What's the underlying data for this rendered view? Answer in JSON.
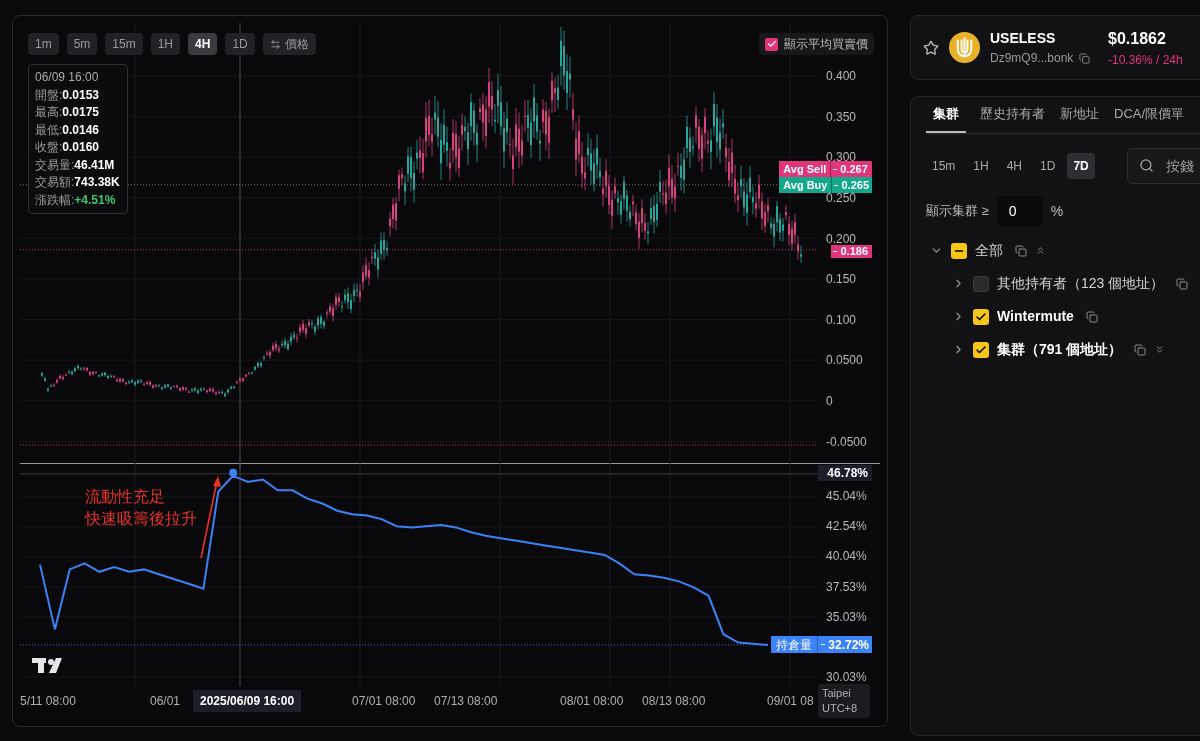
{
  "chart_panel": {
    "intervals": [
      {
        "label": "1m",
        "selected": false
      },
      {
        "label": "5m",
        "selected": false
      },
      {
        "label": "15m",
        "selected": false
      },
      {
        "label": "1H",
        "selected": false
      },
      {
        "label": "4H",
        "selected": true
      },
      {
        "label": "1D",
        "selected": false
      }
    ],
    "price_toggle": "價格",
    "avg_price_toggle": {
      "label": "顯示平均買賣價",
      "checked": true
    },
    "ohlc_tooltip": {
      "date": "06/09 16:00",
      "rows": [
        {
          "label": "開盤:",
          "value": "0.0153",
          "kind": "plain"
        },
        {
          "label": "最高:",
          "value": "0.0175",
          "kind": "plain"
        },
        {
          "label": "最低:",
          "value": "0.0146",
          "kind": "plain"
        },
        {
          "label": "收盤:",
          "value": "0.0160",
          "kind": "plain"
        },
        {
          "label": "交易量:",
          "value": "46.41M",
          "kind": "plain"
        },
        {
          "label": "交易額:",
          "value": "743.38K",
          "kind": "plain"
        },
        {
          "label": "漲跌幅:",
          "value": "+4.51%",
          "kind": "change"
        }
      ]
    },
    "price_axis": [
      "0.400",
      "0.350",
      "0.300",
      "0.250",
      "0.200",
      "0.150",
      "0.100",
      "0.0500",
      "0",
      "-0.0500"
    ],
    "price_badges": [
      {
        "label": "Avg Sell",
        "value": "0.267",
        "color": "#e0357a"
      },
      {
        "label": "Avg Buy",
        "value": "0.265",
        "color": "#14a88a"
      }
    ],
    "last_price_badge": "0.186",
    "holdings_chart": {
      "annotation": [
        "流動性充足",
        "快速吸籌後拉升"
      ],
      "crosshair_value": "46.78%",
      "last_value": "32.72%",
      "chart_data": {
        "type": "line",
        "grid": true,
        "ylim": [
          29.28,
          47.79
        ],
        "categories": [
          null,
          null,
          null,
          null,
          null,
          null,
          null,
          null,
          null,
          null,
          null,
          null,
          null,
          null,
          null,
          null,
          null,
          null,
          null,
          null,
          null,
          null,
          null,
          null,
          null,
          null,
          null,
          null,
          null,
          null,
          null,
          null,
          null,
          null,
          null,
          null,
          null,
          null,
          null,
          null,
          null,
          null,
          null,
          null,
          null,
          null,
          null,
          null,
          null,
          null
        ],
        "yticks": [
          {
            "value": 45.04,
            "label": "45.04%"
          },
          {
            "value": 42.54,
            "label": "42.54%"
          },
          {
            "value": 40.04,
            "label": "40.04%"
          },
          {
            "value": 37.53,
            "label": "37.53%"
          },
          {
            "value": 35.03,
            "label": "35.03%"
          },
          {
            "value": 30.03,
            "label": "30.03%"
          }
        ],
        "series": [
          {
            "name": "持倉量",
            "color": "#3b82f6",
            "values": [
              39.4,
              34,
              39,
              39.5,
              38.8,
              39.2,
              38.8,
              39,
              38.6,
              38.2,
              37.8,
              37.4,
              45.5,
              46.8,
              46.3,
              46.5,
              45.6,
              45.6,
              44.9,
              44.5,
              43.9,
              43.6,
              43.5,
              43.2,
              42.6,
              42.5,
              42.6,
              42.7,
              42.5,
              42.1,
              41.8,
              41.6,
              41.4,
              41.2,
              41,
              40.8,
              40.6,
              40.4,
              40.2,
              39.5,
              38.6,
              38.5,
              38.3,
              38,
              37.5,
              36.8,
              33.6,
              32.9,
              32.8,
              32.7
            ]
          }
        ]
      }
    },
    "time_axis": [
      {
        "label": "5/11 08:00",
        "selected": false
      },
      {
        "label": "06/01",
        "selected": false
      },
      {
        "label": "2025/06/09 16:00",
        "selected": true
      },
      {
        "label": "07/01 08:00",
        "selected": false
      },
      {
        "label": "07/13 08:00",
        "selected": false
      },
      {
        "label": "08/01 08:00",
        "selected": false
      },
      {
        "label": "08/13 08:00",
        "selected": false
      },
      {
        "label": "09/01 08",
        "selected": false
      }
    ],
    "timezone": [
      "Taipei",
      "UTC+8"
    ]
  },
  "token": {
    "favorite": false,
    "symbol": "USELESS",
    "address": "Dz9mQ9...bonk",
    "price": "$0.1862",
    "change": "-10.36% / 24h"
  },
  "holders_panel": {
    "tabs": [
      {
        "label": "集群",
        "selected": true
      },
      {
        "label": "歷史持有者",
        "selected": false
      },
      {
        "label": "新地址",
        "selected": false
      },
      {
        "label": "DCA/限價單",
        "selected": false
      }
    ],
    "ranges": [
      {
        "label": "15m",
        "selected": false
      },
      {
        "label": "1H",
        "selected": false
      },
      {
        "label": "4H",
        "selected": false
      },
      {
        "label": "1D",
        "selected": false
      },
      {
        "label": "7D",
        "selected": true
      }
    ],
    "search": {
      "placeholder": "按錢"
    },
    "threshold": {
      "label": "顯示集群 ≥",
      "value": "0",
      "unit": "%"
    },
    "tree": [
      {
        "label": "全部",
        "indeterminate": true,
        "expanded": true,
        "children": [
          {
            "label": "其他持有者（123 個地址）",
            "checked": false,
            "expanded": false
          },
          {
            "label": "Wintermute",
            "checked": true,
            "expanded": false
          },
          {
            "label": "集群（791 個地址）",
            "checked": true,
            "expanded": false
          }
        ]
      }
    ]
  }
}
